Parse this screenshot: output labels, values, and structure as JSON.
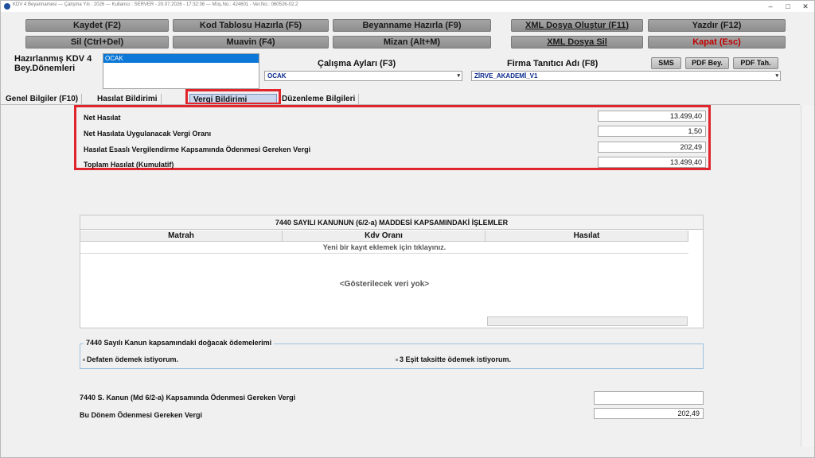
{
  "window": {
    "title": "KDV 4 Beyannamesi  ---  Çalışma Yılı : 2026  ---  Kullanıcı : SERVER - 20.07.2026 - 17:32:36  ---  Müş.No.: 424601 - Ver.No.: 060526-02.2",
    "minimize": "–",
    "maximize": "□",
    "close": "✕"
  },
  "toolbar": {
    "row1": [
      "Kaydet (F2)",
      "Kod Tablosu Hazırla (F5)",
      "Beyanname Hazırla (F9)",
      "XML Dosya Oluştur (F11)",
      "Yazdır (F12)"
    ],
    "row2": [
      "Sil (Ctrl+Del)",
      "Muavin (F4)",
      "Mizan (Alt+M)",
      "XML Dosya Sil",
      "Kapat (Esc)"
    ]
  },
  "periods": {
    "label": "Hazırlanmış KDV 4 Bey.Dönemleri",
    "selected": "OCAK"
  },
  "filters": {
    "months_label": "Çalışma Ayları (F3)",
    "months_value": "OCAK",
    "company_label": "Firma Tanıtıcı Adı (F8)",
    "company_value": "ZİRVE_AKADEMİ_V1"
  },
  "actions": {
    "sms": "SMS",
    "pdf_bey": "PDF Bey.",
    "pdf_tah": "PDF Tah."
  },
  "tabs": [
    "Genel Bilgiler (F10)",
    "Hasılat Bildirimi",
    "Vergi Bildirimi",
    "Düzenleme Bilgileri"
  ],
  "active_tab": "Vergi Bildirimi",
  "tax": {
    "rows": [
      {
        "label": "Net Hasılat",
        "value": "13.499,40"
      },
      {
        "label": "Net Hasılata Uygulanacak Vergi Oranı",
        "value": "1,50"
      },
      {
        "label": "Hasılat Esaslı Vergilendirme Kapsamında Ödenmesi Gereken Vergi",
        "value": "202,49"
      },
      {
        "label": "Toplam Hasılat (Kumulatif)",
        "value": "13.499,40"
      }
    ]
  },
  "grid": {
    "title": "7440 SAYILI KANUNUN (6/2-a) MADDESİ KAPSAMINDAKİ İŞLEMLER",
    "columns": [
      "Matrah",
      "Kdv Oranı",
      "Hasılat"
    ],
    "add_row_text": "Yeni bir kayıt eklemek için tıklayınız.",
    "empty_text": "<Gösterilecek veri yok>"
  },
  "payments": {
    "title": "7440 Sayılı Kanun kapsamındaki doğacak ödemelerimi",
    "option1": "Defaten ödemek istiyorum.",
    "option2": "3 Eşit taksitte ödemek istiyorum."
  },
  "summary": {
    "label1": "7440 S. Kanun (Md 6/2-a) Kapsamında Ödenmesi Gereken Vergi",
    "value1": "",
    "label2": "Bu Dönem Ödenmesi Gereken Vergi",
    "value2": "202,49"
  }
}
